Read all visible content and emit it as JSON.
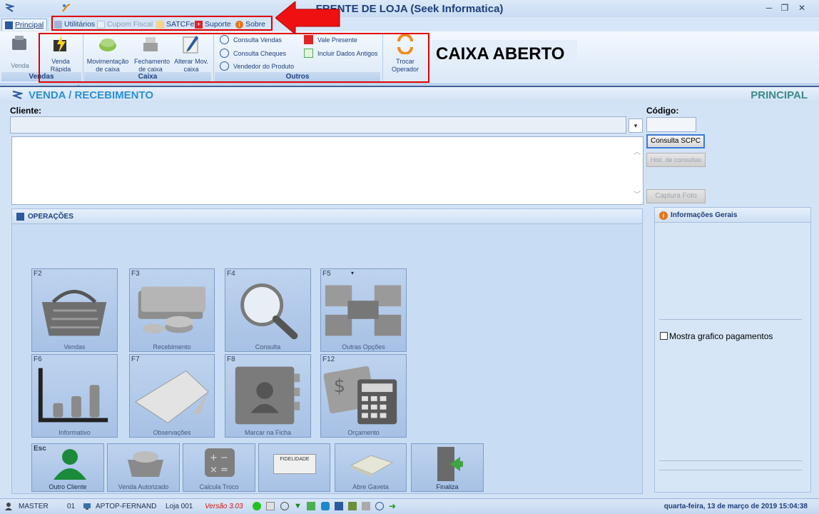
{
  "window": {
    "title": "FRENTE DE LOJA (Seek Informatica)",
    "controls": [
      "─",
      "❐",
      "✕"
    ]
  },
  "menu": {
    "tabs": [
      {
        "label": "Principal",
        "active": true
      },
      {
        "label": "Utilitários"
      },
      {
        "label": "Cupom Fiscal"
      },
      {
        "label": "SATCFe"
      },
      {
        "label": "Suporte"
      },
      {
        "label": "Sobre"
      }
    ]
  },
  "ribbon": {
    "vendas": {
      "label": "Vendas",
      "buttons": [
        "Venda",
        "Venda Rápida"
      ]
    },
    "caixa": {
      "label": "Caixa",
      "buttons": [
        "Movimentação de caixa",
        "Fechamento de caixa",
        "Alterar Mov. caixa"
      ]
    },
    "outros": {
      "label": "Outros",
      "items": [
        "Consulta Vendas",
        "Consulta Cheques",
        "Vendedor do Produto",
        "Vale Presente",
        "Incluir Dados Antigos"
      ],
      "trocar": "Trocar Operador"
    },
    "status_text": "CAIXA ABERTO"
  },
  "section": {
    "left_title": "VENDA / RECEBIMENTO",
    "right_title": "PRINCIPAL"
  },
  "form": {
    "cliente_label": "Cliente:",
    "codigo_label": "Código:",
    "consulta_scpc": "Consulta SCPC",
    "hist_consultas": "Hist. de consultas",
    "captura_foto": "Captura Foto"
  },
  "operacoes": {
    "title": "OPERAÇÕES",
    "tiles": [
      {
        "key": "F2",
        "label": "Vendas"
      },
      {
        "key": "F3",
        "label": "Recebimento"
      },
      {
        "key": "F4",
        "label": "Consulta"
      },
      {
        "key": "F5",
        "label": "Outras Opções"
      },
      {
        "key": "F6",
        "label": "Informativo"
      },
      {
        "key": "F7",
        "label": "Observações"
      },
      {
        "key": "F8",
        "label": "Marcar na Ficha"
      },
      {
        "key": "F12",
        "label": "Orçamento"
      }
    ],
    "bottom": [
      {
        "key": "Esc",
        "label": "Outro Cliente"
      },
      {
        "key": "",
        "label": "Venda Autorizado"
      },
      {
        "key": "",
        "label": "Calcula Troco"
      },
      {
        "key": "",
        "label": "FIDELIDADE"
      },
      {
        "key": "",
        "label": "Abre Gaveta"
      },
      {
        "key": "",
        "label": "Finaliza"
      }
    ]
  },
  "info": {
    "title": "Informações Gerais",
    "checkbox_label": "Mostra grafico pagamentos"
  },
  "statusbar": {
    "user": "MASTER",
    "terminal": "01",
    "machine": "APTOP-FERNAND(",
    "loja": "Loja 001",
    "versao": "Versão 3.03",
    "datetime": "quarta-feira, 13 de março de 2019 15:04:38"
  },
  "colors": {
    "accent": "#2a8fd6",
    "annotation": "#e00000"
  }
}
